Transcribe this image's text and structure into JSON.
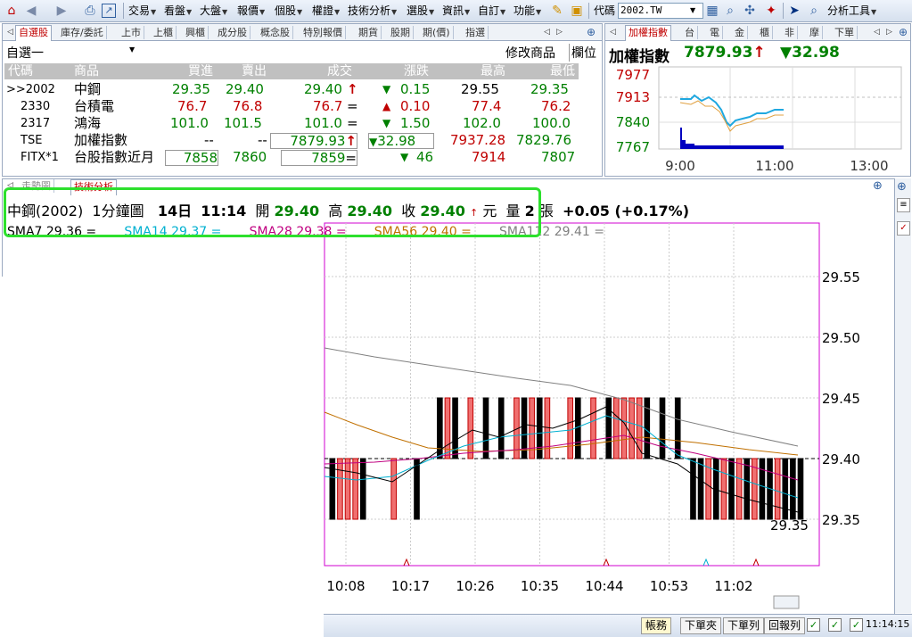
{
  "toolbar": {
    "menus": [
      "交易",
      "看盤",
      "大盤",
      "報價",
      "個股",
      "權證",
      "技術分析",
      "選股",
      "資訊",
      "自訂",
      "功能"
    ],
    "code_label": "代碼",
    "code_value": "2002.TW",
    "analysis_tools": "分析工具"
  },
  "quote_panel": {
    "tabs": [
      "自選股",
      "庫存/委託",
      "上市",
      "上櫃",
      "興櫃",
      "成分股",
      "概念股",
      "特別報價",
      "期貨",
      "股期",
      "期(價)",
      "指選"
    ],
    "list_name": "自選一",
    "edit_label": "修改商品",
    "column_label": "欄位",
    "headers": [
      "代碼",
      "商品",
      "買進",
      "賣出",
      "成交",
      "漲跌",
      "最高",
      "最低"
    ],
    "rows": [
      {
        "code": ">>2002",
        "name": "中鋼",
        "bid": "29.35",
        "ask": "29.40",
        "last": "29.40",
        "last_mark": "↑",
        "chg": "0.15",
        "chg_dir": "▼",
        "high": "29.55",
        "low": "29.35",
        "color": "g"
      },
      {
        "code": "2330",
        "name": "台積電",
        "bid": "76.7",
        "ask": "76.8",
        "last": "76.7",
        "last_mark": "=",
        "chg": "0.10",
        "chg_dir": "▲",
        "high": "77.4",
        "low": "76.2",
        "color": "r"
      },
      {
        "code": "2317",
        "name": "鴻海",
        "bid": "101.0",
        "ask": "101.5",
        "last": "101.0",
        "last_mark": "=",
        "chg": "1.50",
        "chg_dir": "▼",
        "high": "102.0",
        "low": "100.0",
        "color": "g"
      },
      {
        "code": "TSE",
        "name": "加權指數",
        "bid": "--",
        "ask": "--",
        "last": "7879.93",
        "last_mark": "↑",
        "chg": "32.98",
        "chg_dir": "▼",
        "high": "7937.28",
        "low": "7829.76",
        "color": "g"
      },
      {
        "code": "FITX*1",
        "name": "台股指數近月",
        "bid": "7858",
        "ask": "7860",
        "last": "7859",
        "last_mark": "=",
        "chg": "46",
        "chg_dir": "▼",
        "high": "7914",
        "low": "7807",
        "color": "g"
      }
    ]
  },
  "index_panel": {
    "tabs": [
      "加權指數",
      "台",
      "電",
      "金",
      "櫃",
      "非",
      "摩",
      "下單"
    ],
    "title": "加權指數",
    "value": "7879.93",
    "value_mark": "↑",
    "change": "▼32.98",
    "y_labels": [
      "7977",
      "7913",
      "7840",
      "7767"
    ],
    "x_labels": [
      "9:00",
      "11:00",
      "13:00"
    ]
  },
  "chart_panel": {
    "tabs": [
      "走勢圖",
      "技術分析"
    ],
    "info": {
      "name": "中鋼(2002)",
      "period": "1分鐘圖",
      "date": "14日",
      "time": "11:14",
      "open_label": "開",
      "open": "29.40",
      "high_label": "高",
      "high": "29.40",
      "close_label": "收",
      "close": "29.40",
      "unit": "元",
      "vol_label": "量",
      "vol": "2",
      "vol_unit": "張",
      "change": "+0.05 (+0.17%)"
    },
    "sma": [
      {
        "label": "SMA7 29.36 =",
        "color": "#000000"
      },
      {
        "label": "SMA14 29.37 =",
        "color": "#00b0d0"
      },
      {
        "label": "SMA28 29.38 =",
        "color": "#c00080"
      },
      {
        "label": "SMA56 29.40 =",
        "color": "#c07000"
      },
      {
        "label": "SMA112 29.41 =",
        "color": "#808080"
      }
    ]
  },
  "chart_data": {
    "type": "bar",
    "title": "中鋼(2002) 1分鐘圖",
    "y_ticks": [
      "29.55",
      "29.50",
      "29.45",
      "29.40",
      "29.35"
    ],
    "x_ticks": [
      "10:08",
      "10:17",
      "10:26",
      "10:35",
      "10:44",
      "10:53",
      "11:02"
    ],
    "ylim": [
      29.3,
      29.6
    ],
    "last_price_label": "29.35",
    "bars": [
      {
        "t": 0,
        "o": 29.4,
        "c": 29.35
      },
      {
        "t": 1,
        "o": 29.35,
        "c": 29.4
      },
      {
        "t": 2,
        "o": 29.35,
        "c": 29.4
      },
      {
        "t": 3,
        "o": 29.35,
        "c": 29.4
      },
      {
        "t": 4,
        "o": 29.4,
        "c": 29.35
      },
      {
        "t": 8,
        "o": 29.35,
        "c": 29.4
      },
      {
        "t": 11,
        "o": 29.4,
        "c": 29.35
      },
      {
        "t": 14,
        "o": 29.45,
        "c": 29.4
      },
      {
        "t": 15,
        "o": 29.4,
        "c": 29.45
      },
      {
        "t": 16,
        "o": 29.45,
        "c": 29.4
      },
      {
        "t": 18,
        "o": 29.4,
        "c": 29.45
      },
      {
        "t": 20,
        "o": 29.45,
        "c": 29.4
      },
      {
        "t": 22,
        "o": 29.45,
        "c": 29.4
      },
      {
        "t": 24,
        "o": 29.4,
        "c": 29.45
      },
      {
        "t": 25,
        "o": 29.45,
        "c": 29.4
      },
      {
        "t": 26,
        "o": 29.4,
        "c": 29.45
      },
      {
        "t": 27,
        "o": 29.45,
        "c": 29.4
      },
      {
        "t": 28,
        "o": 29.4,
        "c": 29.45
      },
      {
        "t": 31,
        "o": 29.4,
        "c": 29.45
      },
      {
        "t": 32,
        "o": 29.45,
        "c": 29.4
      },
      {
        "t": 34,
        "o": 29.4,
        "c": 29.45
      },
      {
        "t": 36,
        "o": 29.45,
        "c": 29.4
      },
      {
        "t": 37,
        "o": 29.4,
        "c": 29.45
      },
      {
        "t": 38,
        "o": 29.4,
        "c": 29.45
      },
      {
        "t": 39,
        "o": 29.4,
        "c": 29.45
      },
      {
        "t": 40,
        "o": 29.4,
        "c": 29.45
      },
      {
        "t": 41,
        "o": 29.45,
        "c": 29.4
      },
      {
        "t": 43,
        "o": 29.45,
        "c": 29.4
      },
      {
        "t": 45,
        "o": 29.45,
        "c": 29.4
      },
      {
        "t": 47,
        "o": 29.4,
        "c": 29.35
      },
      {
        "t": 48,
        "o": 29.4,
        "c": 29.35
      },
      {
        "t": 49,
        "o": 29.35,
        "c": 29.4
      },
      {
        "t": 50,
        "o": 29.4,
        "c": 29.35
      },
      {
        "t": 51,
        "o": 29.35,
        "c": 29.4
      },
      {
        "t": 52,
        "o": 29.4,
        "c": 29.35
      },
      {
        "t": 53,
        "o": 29.35,
        "c": 29.4
      },
      {
        "t": 54,
        "o": 29.4,
        "c": 29.35
      },
      {
        "t": 55,
        "o": 29.35,
        "c": 29.4
      },
      {
        "t": 56,
        "o": 29.4,
        "c": 29.35
      },
      {
        "t": 57,
        "o": 29.4,
        "c": 29.35
      },
      {
        "t": 58,
        "o": 29.35,
        "c": 29.4
      },
      {
        "t": 59,
        "o": 29.4,
        "c": 29.35
      },
      {
        "t": 60,
        "o": 29.4,
        "c": 29.35
      },
      {
        "t": 61,
        "o": 29.4,
        "c": 29.35
      }
    ]
  },
  "statusbar": {
    "buttons": [
      "帳務",
      "下單夾",
      "下單列",
      "回報列"
    ],
    "time": "11:14:15"
  }
}
